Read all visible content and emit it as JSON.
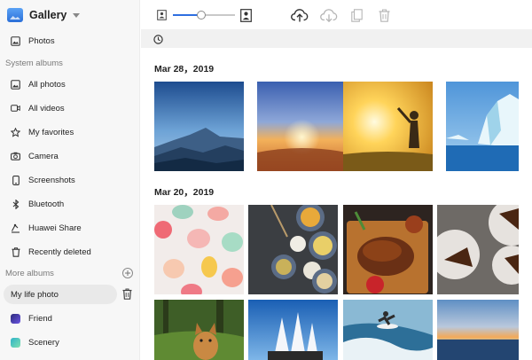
{
  "app": {
    "title": "Gallery"
  },
  "sidebar": {
    "photos_label": "Photos",
    "system_section": "System albums",
    "system_items": [
      {
        "label": "All photos",
        "icon": "image-icon"
      },
      {
        "label": "All videos",
        "icon": "video-icon"
      },
      {
        "label": "My favorites",
        "icon": "star-icon"
      },
      {
        "label": "Camera",
        "icon": "camera-icon"
      },
      {
        "label": "Screenshots",
        "icon": "phone-icon"
      },
      {
        "label": "Bluetooth",
        "icon": "bluetooth-icon"
      },
      {
        "label": "Huawei Share",
        "icon": "share-icon"
      },
      {
        "label": "Recently deleted",
        "icon": "trash-icon"
      }
    ],
    "more_section": "More albums",
    "more_items": [
      {
        "label": "My life photo",
        "active": true
      },
      {
        "label": "Friend",
        "color": "#5b4fd8"
      },
      {
        "label": "Scenery",
        "color": "#3ec8c0"
      }
    ]
  },
  "toolbar": {
    "zoom_level": 0.45,
    "accent": "#2e6fe0"
  },
  "content": {
    "groups": [
      {
        "date": "Mar 28，2019"
      },
      {
        "date": "Mar 20，2019"
      }
    ]
  }
}
